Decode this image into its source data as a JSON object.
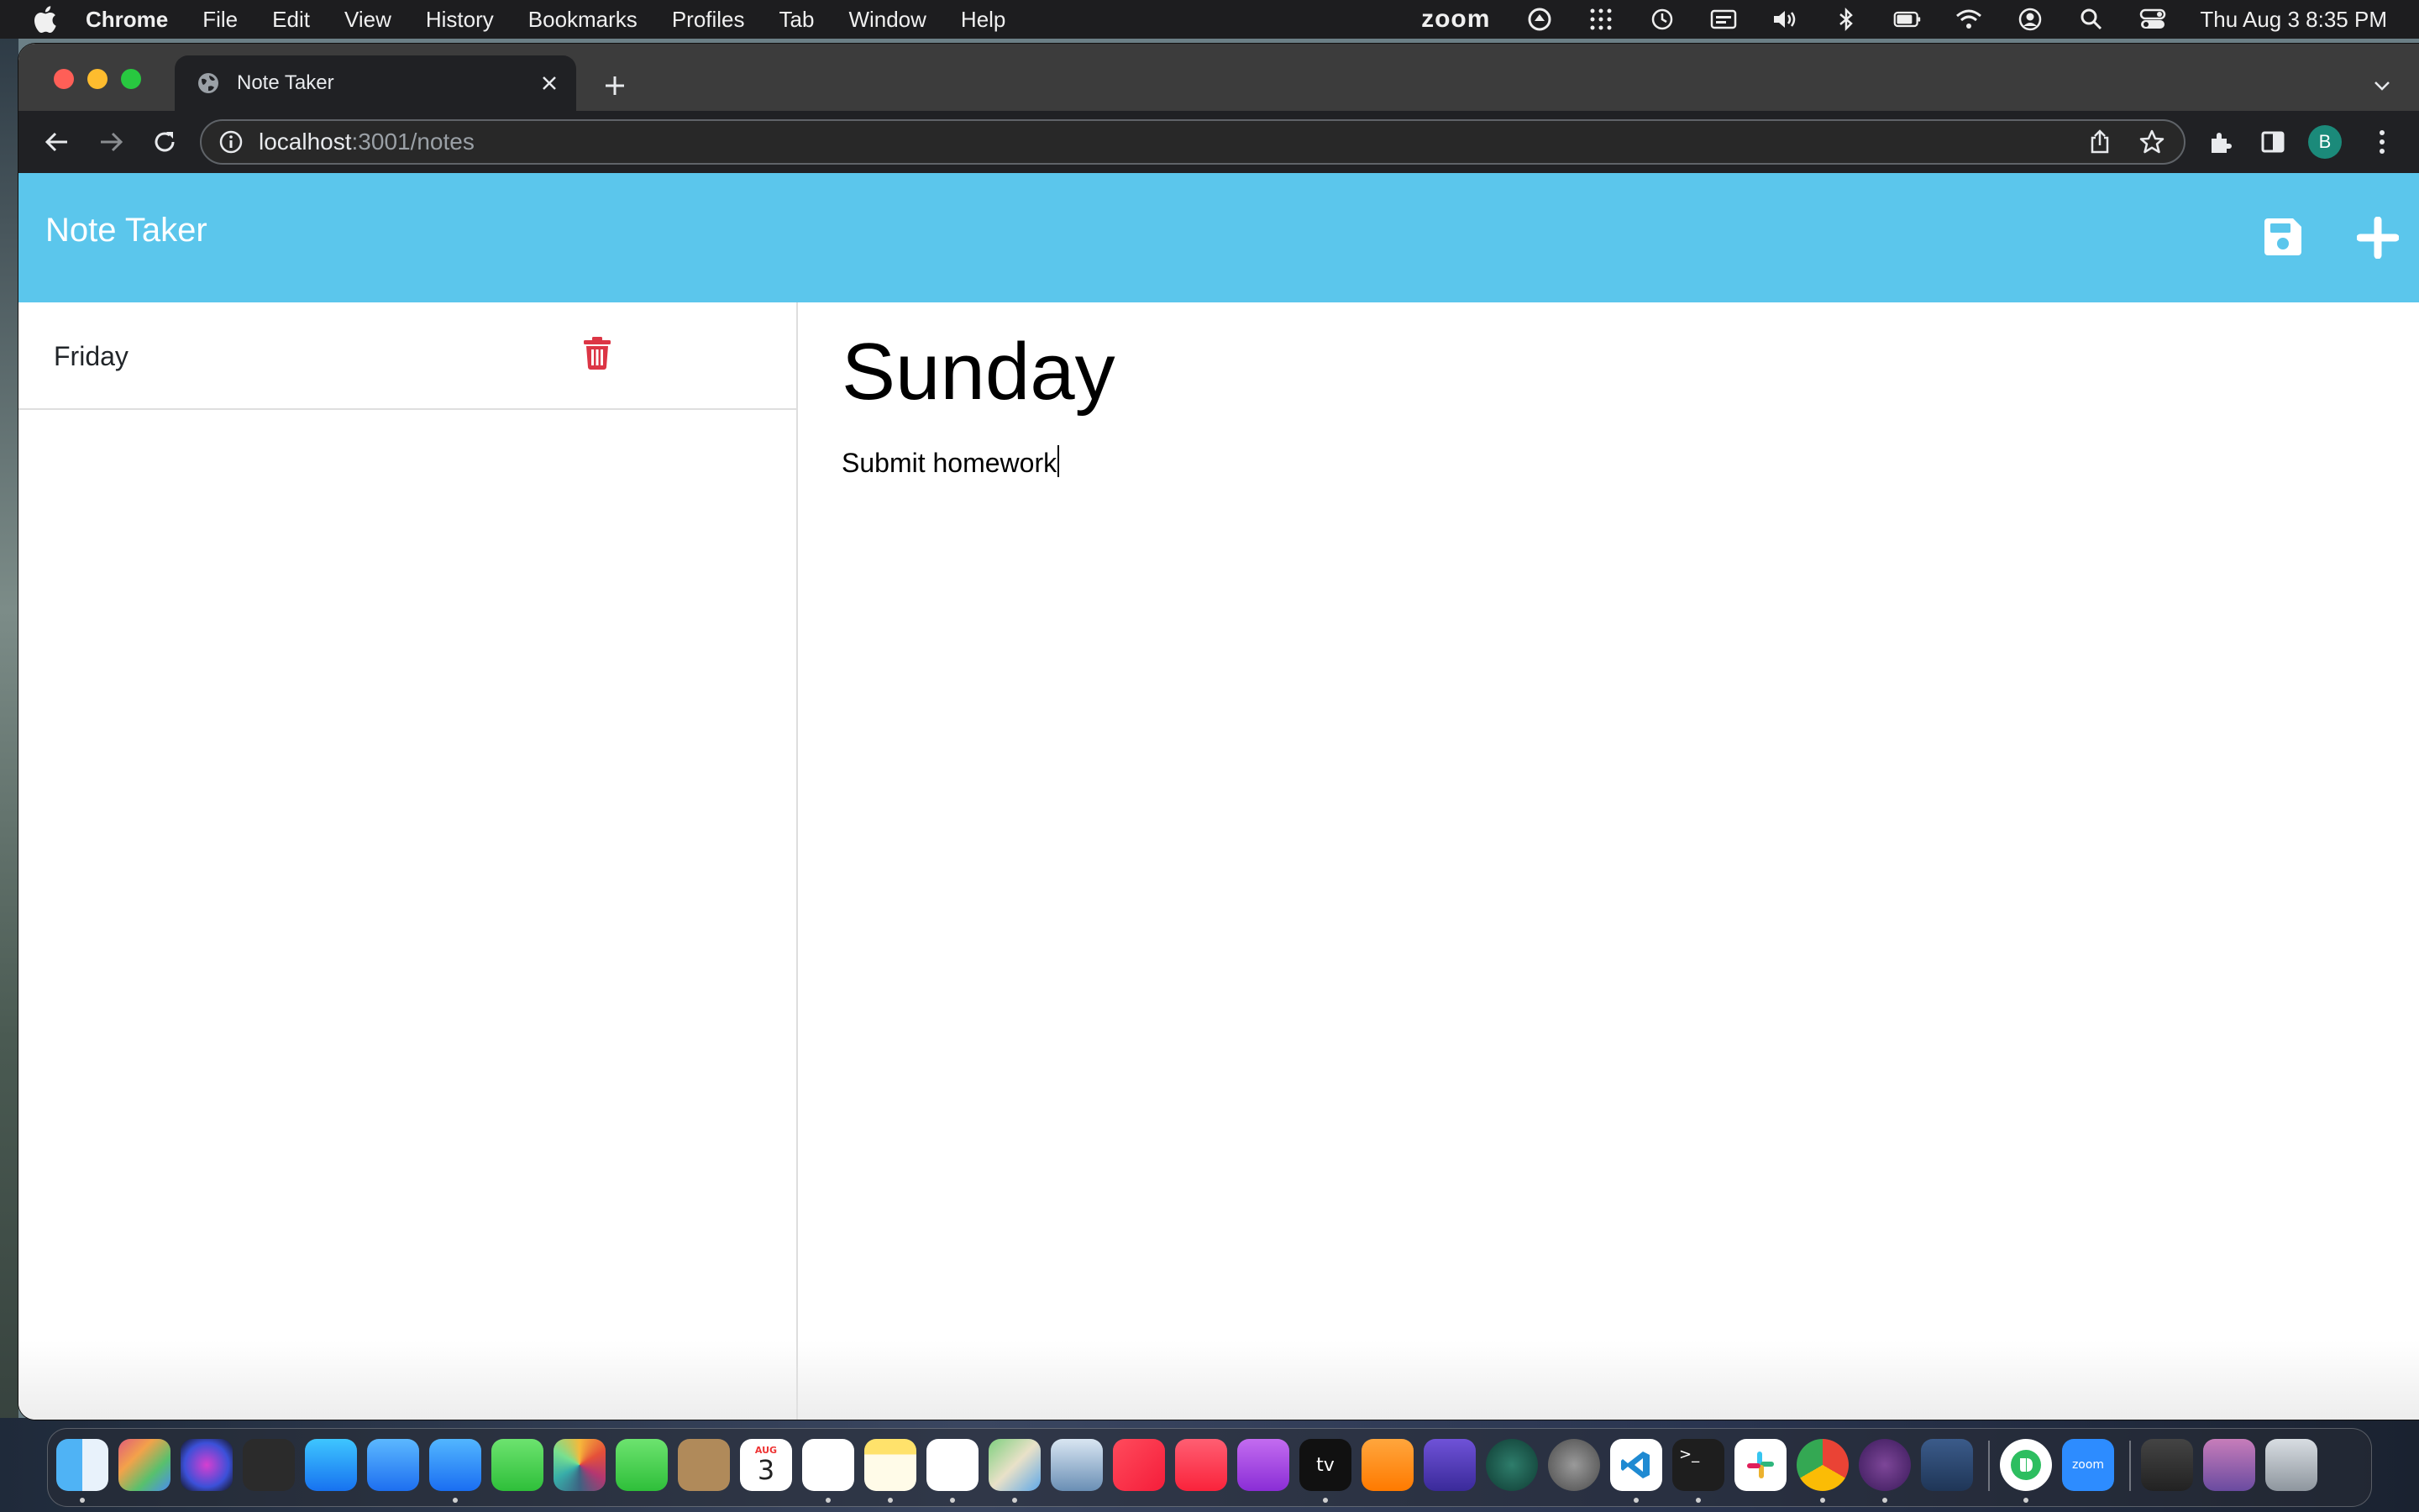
{
  "menubar": {
    "app_name": "Chrome",
    "items": [
      "File",
      "Edit",
      "View",
      "History",
      "Bookmarks",
      "Profiles",
      "Tab",
      "Window",
      "Help"
    ],
    "zoom_label": "zoom",
    "clock": "Thu Aug 3  8:35 PM",
    "status_icons": [
      "zoom-status-icon",
      "screen-share-icon",
      "grid-icon",
      "time-machine-icon",
      "keyboard-input-icon",
      "volume-icon",
      "bluetooth-icon",
      "battery-icon",
      "wifi-icon",
      "user-icon",
      "spotlight-search-icon",
      "control-center-icon"
    ]
  },
  "browser": {
    "tab_title": "Note Taker",
    "url_host": "localhost",
    "url_path": ":3001/notes",
    "profile_initial": "B",
    "icons": [
      "back-icon",
      "forward-icon",
      "reload-icon",
      "info-icon",
      "share-icon",
      "bookmark-star-icon",
      "extensions-icon",
      "side-panel-icon",
      "more-menu-icon"
    ]
  },
  "app": {
    "brand": "Note Taker",
    "header_colors": {
      "navbar": "#5bc6ec",
      "delete": "#dc3545"
    },
    "notes": [
      {
        "title": "Friday"
      }
    ],
    "active_note": {
      "title": "Sunday",
      "text": "Submit homework"
    }
  },
  "dock": {
    "apps": [
      "finder",
      "launchpad",
      "siri",
      "mission-control",
      "app-store",
      "mail",
      "safari",
      "messages",
      "photos",
      "facetime",
      "contacts",
      "calendar",
      "reminders",
      "notes",
      "freeform",
      "maps",
      "preview",
      "news",
      "music",
      "podcasts",
      "apple-tv",
      "books",
      "imovie",
      "time-machine",
      "system-settings",
      "vscode",
      "terminal",
      "slack",
      "chrome",
      "tor-browser",
      "mysql-workbench",
      "evernote",
      "zoom-app",
      "downloads-stack",
      "documents-stack",
      "trash"
    ],
    "calendar_month": "AUG",
    "calendar_day": "3",
    "zoom_app_label": "zoom",
    "tv_label": "tv"
  }
}
